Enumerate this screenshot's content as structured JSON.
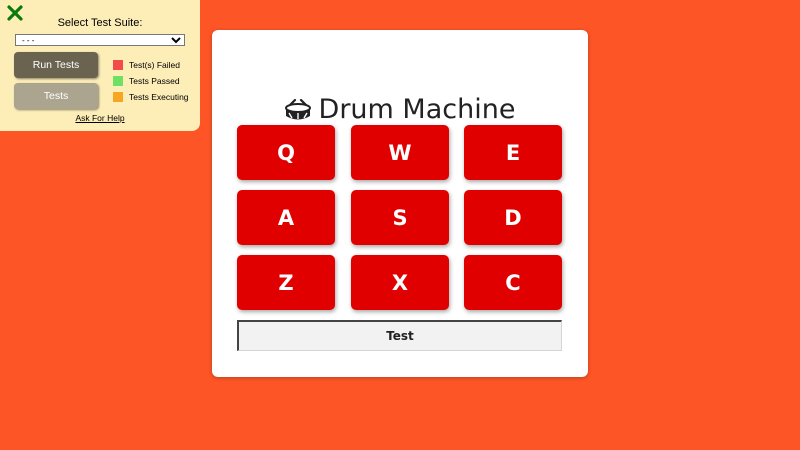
{
  "test_panel": {
    "close_icon": "x-icon",
    "close_color": "#0a7a0a",
    "suite_label": "Select Test Suite:",
    "suite_selected": "- - -",
    "run_button": "Run Tests",
    "tests_button": "Tests",
    "legend": [
      {
        "label": "Test(s) Failed",
        "color": "#f34a4a"
      },
      {
        "label": "Tests Passed",
        "color": "#6ee063"
      },
      {
        "label": "Tests Executing",
        "color": "#f6a623"
      }
    ],
    "help_link": "Ask For Help"
  },
  "drum_machine": {
    "title_icon": "drum-icon",
    "title": "Drum Machine",
    "pads": [
      "Q",
      "W",
      "E",
      "A",
      "S",
      "D",
      "Z",
      "X",
      "C"
    ],
    "display": "Test"
  },
  "colors": {
    "background": "#fe5526",
    "pad": "#e10000",
    "panel": "#fdeeb8"
  }
}
